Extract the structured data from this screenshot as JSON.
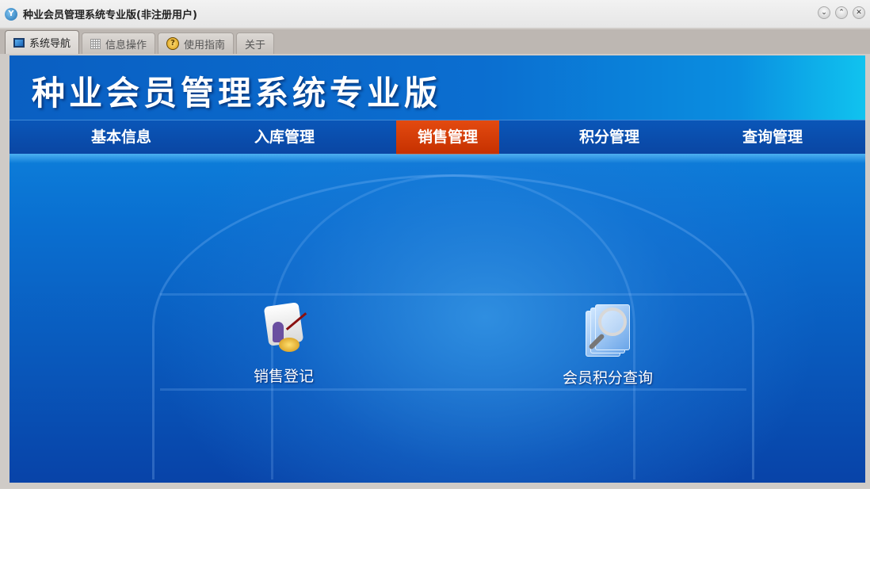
{
  "window": {
    "title": "种业会员管理系统专业版(非注册用户)",
    "controls": [
      "minimize",
      "maximize",
      "close"
    ]
  },
  "tabs": [
    {
      "label": "系统导航",
      "icon": "monitor-icon",
      "active": true
    },
    {
      "label": "信息操作",
      "icon": "grid-icon"
    },
    {
      "label": "使用指南",
      "icon": "help-icon"
    },
    {
      "label": "关于"
    }
  ],
  "banner": {
    "title": "种业会员管理系统专业版"
  },
  "nav": [
    {
      "label": "基本信息"
    },
    {
      "label": "入库管理"
    },
    {
      "label": "销售管理",
      "active": true
    },
    {
      "label": "积分管理"
    },
    {
      "label": "查询管理"
    }
  ],
  "functions": [
    {
      "label": "销售登记",
      "icon": "sales-register-icon"
    },
    {
      "label": "会员积分查询",
      "icon": "search-document-icon"
    }
  ],
  "colors": {
    "accent": "#d23a05",
    "nav": "#0a4fb0"
  }
}
